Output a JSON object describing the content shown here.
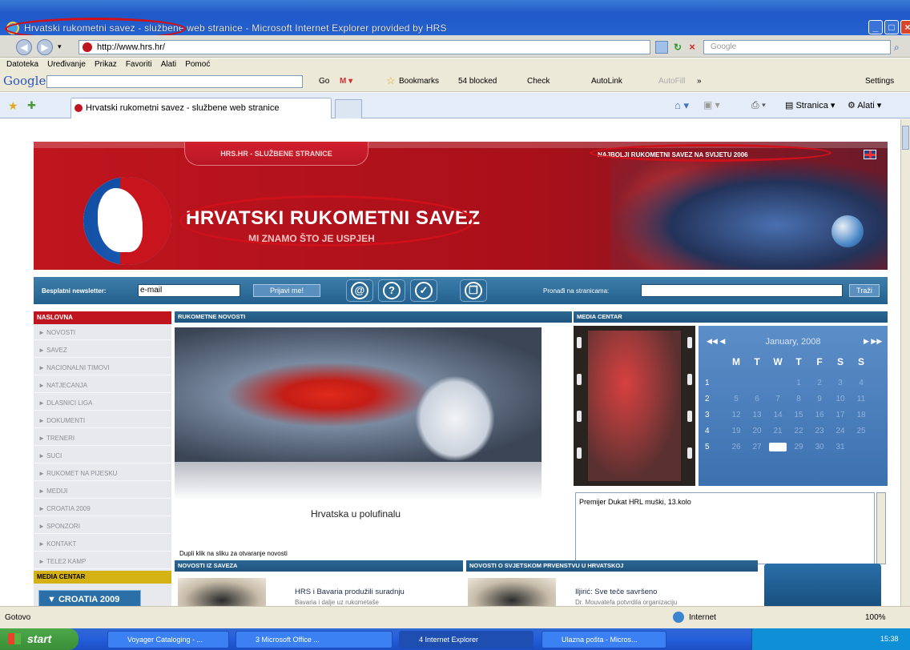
{
  "window": {
    "title": "Hrvatski rukometni savez - službene web stranice - Microsoft Internet Explorer provided by HRS",
    "url": "http://www.hrs.hr/",
    "search_placeholder": "Google"
  },
  "menu": [
    "Datoteka",
    "Uređivanje",
    "Prikaz",
    "Favoriti",
    "Alati",
    "Pomoć"
  ],
  "google_toolbar": {
    "logo": "Google",
    "items": [
      "Go",
      "Bookmarks",
      "54 blocked",
      "Check",
      "AutoLink",
      "AutoFill",
      "»",
      "Settings"
    ]
  },
  "tabs": {
    "active": "Hrvatski rukometni savez - službene web stranice",
    "right_items": [
      "Stranica",
      "Alati"
    ]
  },
  "site": {
    "header_tab": "HRS.HR - SLUŽBENE STRANICE",
    "best": "NAJBOLJI RUKOMETNI SAVEZ NA SVIJETU 2006",
    "title": "HRVATSKI RUKOMETNI SAVEZ",
    "subtitle": "MI ZNAMO ŠTO JE USPJEH",
    "newsletter_label": "Besplatni newsletter:",
    "newsletter_value": "e-mail",
    "newsletter_button": "Prijavi me!",
    "find_label": "Pronađi na stranicama:",
    "find_button": "Traži",
    "nav_icons": [
      "@",
      "?",
      "✓",
      "❐"
    ],
    "left_head": "NASLOVNA",
    "left_items": [
      "NOVOSTI",
      "SAVEZ",
      "NACIONALNI TIMOVI",
      "NATJECANJA",
      "DLASNICI LIGA",
      "DOKUMENTI",
      "TRENERI",
      "SUCI",
      "RUKOMET NA PIJESKU",
      "MEDIJI",
      "CROATIA 2009",
      "SPONZORI",
      "KONTAKT",
      "TELE2 KAMP"
    ],
    "media_label": "MEDIA CENTAR",
    "croatia_button": "CROATIA 2009",
    "news_head": "RUKOMETNE NOVOSTI",
    "news_caption": "Hrvatska u polufinalu",
    "news_hint": "Dupli klik na sliku za otvaranje novosti",
    "media_head": "MEDIA CENTAR",
    "ticker": "Premijer Dukat HRL muški, 13.kolo",
    "news2_head": "NOVOSTI IZ SAVEZA",
    "news2_title": "HRS i Bavaria produžili suradnju",
    "news2_desc": "Bavaria i dalje uz rukometaše",
    "news3_head": "NOVOSTI O SVJETSKOM PRVENSTVU U HRVATSKOJ",
    "news3_title": "Iljirić: Sve teče savršeno",
    "news3_desc": "Dr. Mouvatefa potvrdila organizaciju"
  },
  "calendar": {
    "month": "January, 2008",
    "dow": [
      "M",
      "T",
      "W",
      "T",
      "F",
      "S",
      "S"
    ],
    "weeks": [
      {
        "n": "1",
        "days": [
          "",
          "",
          "",
          "1",
          "2",
          "3",
          "4"
        ]
      },
      {
        "n": "2",
        "days": [
          "5",
          "6",
          "7",
          "8",
          "9",
          "10",
          "11"
        ]
      },
      {
        "n": "3",
        "days": [
          "12",
          "13",
          "14",
          "15",
          "16",
          "17",
          "18"
        ]
      },
      {
        "n": "4",
        "days": [
          "19",
          "20",
          "21",
          "22",
          "23",
          "24",
          "25"
        ]
      },
      {
        "n": "5",
        "days": [
          "26",
          "27",
          "28",
          "29",
          "30",
          "31",
          ""
        ]
      }
    ],
    "today": "28"
  },
  "status": {
    "left": "Gotovo",
    "zone": "Internet",
    "zoom": "100%"
  },
  "taskbar": {
    "start": "start",
    "tasks": [
      "Voyager Cataloging - ...",
      "3 Microsoft Office ...",
      "4 Internet Explorer",
      "Ulazna pošta - Micros..."
    ],
    "time": "15:38"
  },
  "colors": {
    "brand_red": "#c0151e",
    "brand_blue": "#24608e",
    "annotation_red": "#d0111b"
  }
}
